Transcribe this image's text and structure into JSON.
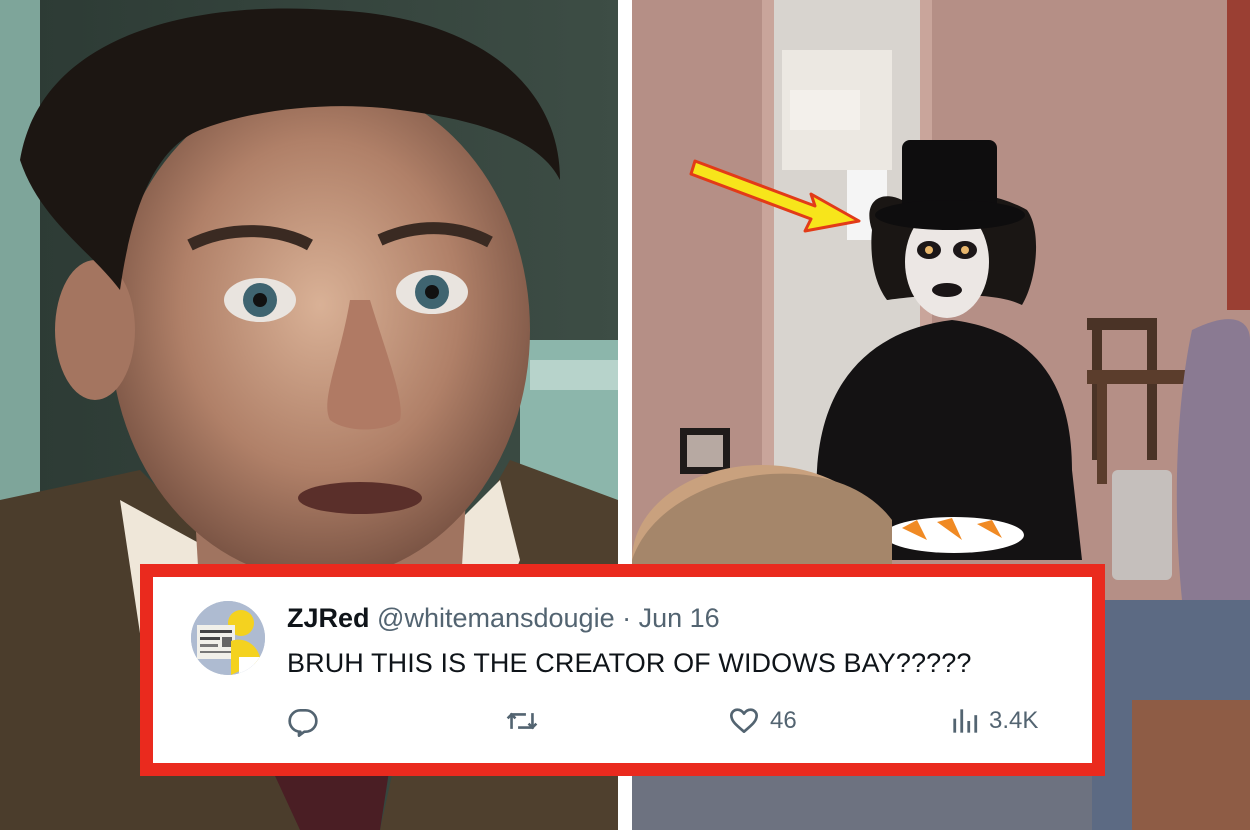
{
  "tweet": {
    "display_name": "ZJRed",
    "handle": "@whitemansdougie",
    "separator": "·",
    "date": "Jun 16",
    "text": "BRUH THIS IS THE CREATOR OF WIDOWS BAY?????",
    "actions": {
      "reply_icon": "reply-icon",
      "retweet_icon": "retweet-icon",
      "like_icon": "heart-icon",
      "like_count": "46",
      "views_icon": "views-bar-chart-icon",
      "views_count": "3.4K"
    }
  },
  "colors": {
    "card_border": "#ea2a1e",
    "arrow": "#f7e51b",
    "name_text": "#0f1419",
    "secondary_text": "#536471"
  }
}
